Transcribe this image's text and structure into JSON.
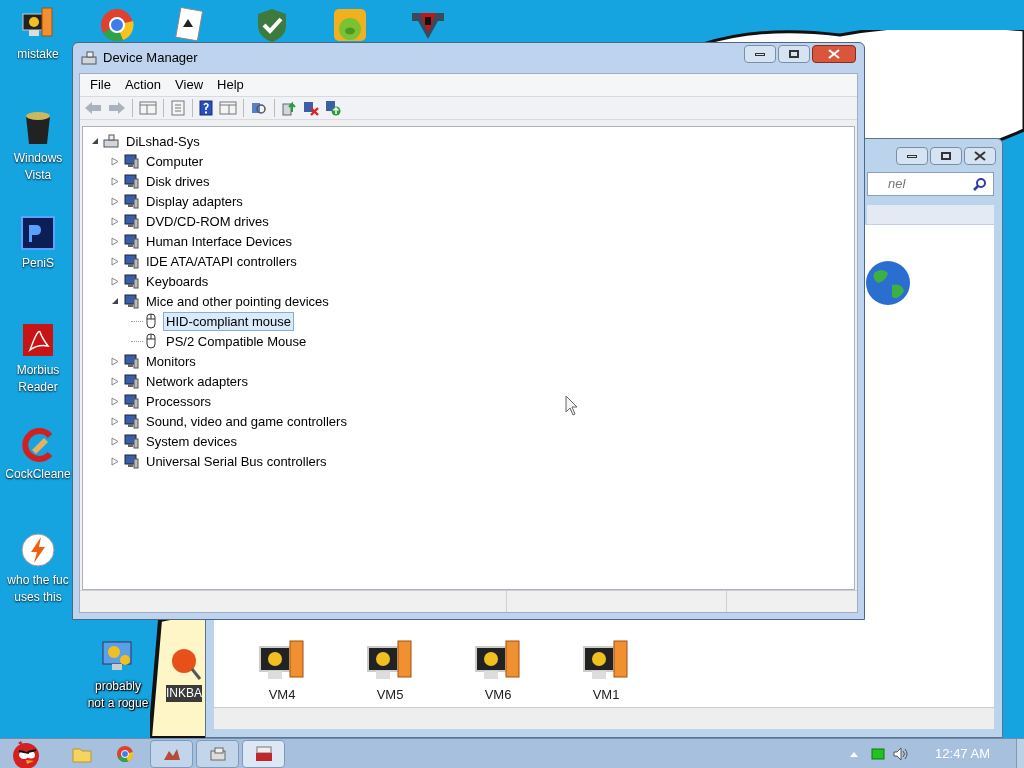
{
  "desktop_icons": [
    {
      "lines": [
        "mistake"
      ]
    },
    {
      "lines": [
        "Windows",
        "Vista"
      ]
    },
    {
      "lines": [
        "PeniS"
      ]
    },
    {
      "lines": [
        "Morbius",
        "Reader"
      ]
    },
    {
      "lines": [
        "CockCleane"
      ]
    },
    {
      "lines": [
        "who the fuc",
        "uses this"
      ]
    }
  ],
  "desktop_icons_bottom": [
    {
      "lines": [
        "probably",
        "not a rogue"
      ]
    },
    {
      "lines": [
        "INKBA"
      ]
    }
  ],
  "back_window": {
    "search": {
      "placeholder": "nel"
    },
    "devices": [
      {
        "label": "VM4"
      },
      {
        "label": "VM5"
      },
      {
        "label": "VM6"
      },
      {
        "label": "VM1"
      }
    ]
  },
  "window": {
    "title": "Device Manager"
  },
  "menu": [
    "File",
    "Action",
    "View",
    "Help"
  ],
  "tree": [
    {
      "label": "DiLshad-Sys",
      "expanded": true,
      "selected": false,
      "children": [
        {
          "label": "Computer",
          "expanded": false,
          "selected": false
        },
        {
          "label": "Disk drives",
          "expanded": false,
          "selected": false
        },
        {
          "label": "Display adapters",
          "expanded": false,
          "selected": false
        },
        {
          "label": "DVD/CD-ROM drives",
          "expanded": false,
          "selected": false
        },
        {
          "label": "Human Interface Devices",
          "expanded": false,
          "selected": false
        },
        {
          "label": "IDE ATA/ATAPI controllers",
          "expanded": false,
          "selected": false
        },
        {
          "label": "Keyboards",
          "expanded": false,
          "selected": false
        },
        {
          "label": "Mice and other pointing devices",
          "expanded": true,
          "selected": false,
          "children": [
            {
              "label": "HID-compliant mouse",
              "selected": true
            },
            {
              "label": "PS/2 Compatible Mouse",
              "selected": false
            }
          ]
        },
        {
          "label": "Monitors",
          "expanded": false,
          "selected": false
        },
        {
          "label": "Network adapters",
          "expanded": false,
          "selected": false
        },
        {
          "label": "Processors",
          "expanded": false,
          "selected": false
        },
        {
          "label": "Sound, video and game controllers",
          "expanded": false,
          "selected": false
        },
        {
          "label": "System devices",
          "expanded": false,
          "selected": false
        },
        {
          "label": "Universal Serial Bus controllers",
          "expanded": false,
          "selected": false
        }
      ]
    }
  ],
  "taskbar": {
    "clock": "12:47 AM"
  }
}
